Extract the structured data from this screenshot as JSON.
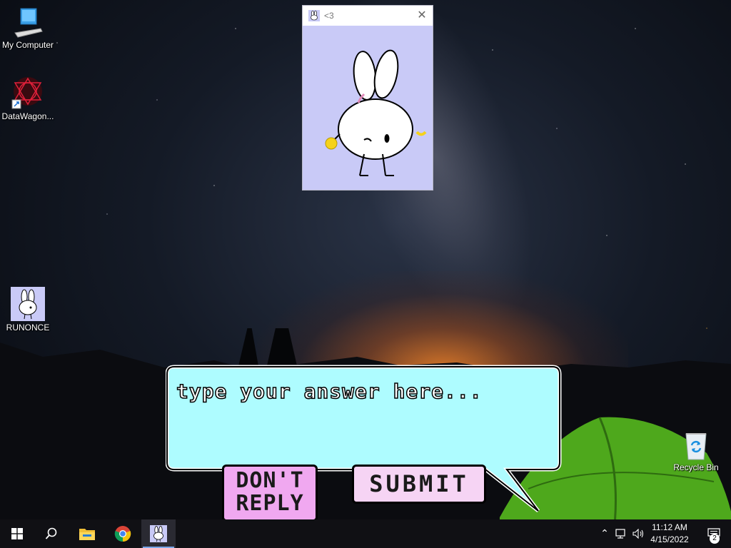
{
  "desktop": {
    "icons": [
      {
        "label": "My Computer"
      },
      {
        "label": "DataWagon..."
      },
      {
        "label": "RUNONCE"
      },
      {
        "label": "Recycle Bin"
      }
    ]
  },
  "popup": {
    "title": "<3",
    "image_icon": "bunny-holding-ball-icon"
  },
  "dialog": {
    "input_placeholder": "type your answer here...",
    "dont_reply_line1": "DON'T",
    "dont_reply_line2": "REPLY",
    "submit_label": "SUBMIT"
  },
  "taskbar": {
    "items": [
      "windows-start-icon",
      "search-icon",
      "file-explorer-icon",
      "chrome-icon",
      "bunny-app-icon"
    ],
    "time": "11:12 AM",
    "date": "4/15/2022",
    "notification_count": "2"
  },
  "colors": {
    "bubble_fill": "#aefcff",
    "dont_reply_fill": "#f0a8f0",
    "submit_fill": "#f6d4f4",
    "popup_bg": "#c9caf7"
  }
}
